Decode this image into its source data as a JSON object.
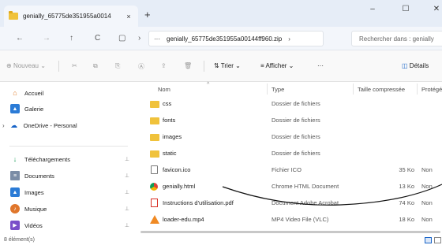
{
  "tab": {
    "title": "genially_65775de351955a0014",
    "close": "×",
    "new": "+"
  },
  "window_controls": {
    "minimize": "–",
    "maximize": "☐",
    "close": "✕"
  },
  "nav": {
    "back": "←",
    "forward": "→",
    "up": "↑",
    "refresh": "C",
    "view": "▢",
    "chevron": "›",
    "more": "···",
    "path": "genially_65775de351955a00144ff960.zip",
    "path_chevron": "›",
    "search_placeholder": "Rechercher dans : genially"
  },
  "toolbar": {
    "new_label": "Nouveau",
    "sort_label": "Trier",
    "view_label": "Afficher",
    "more": "···",
    "details_label": "Détails"
  },
  "sidebar": {
    "items": [
      {
        "label": "Accueil",
        "icon": "home-icon",
        "pinned": false
      },
      {
        "label": "Galerie",
        "icon": "gallery-icon",
        "pinned": false
      },
      {
        "label": "OneDrive - Personal",
        "icon": "cloud-icon",
        "pinned": false
      },
      {
        "label": "Téléchargements",
        "icon": "download-icon",
        "pinned": true
      },
      {
        "label": "Documents",
        "icon": "document-icon",
        "pinned": true
      },
      {
        "label": "Images",
        "icon": "image-icon",
        "pinned": true
      },
      {
        "label": "Musique",
        "icon": "music-icon",
        "pinned": true
      },
      {
        "label": "Vidéos",
        "icon": "video-icon",
        "pinned": true
      }
    ]
  },
  "columns": {
    "name": "Nom",
    "type": "Type",
    "compressed": "Taille compressée",
    "protected": "Protégé"
  },
  "files": [
    {
      "name": "css",
      "type": "Dossier de fichiers",
      "size": "",
      "protected": "",
      "icon": "folder-icon"
    },
    {
      "name": "fonts",
      "type": "Dossier de fichiers",
      "size": "",
      "protected": "",
      "icon": "folder-icon"
    },
    {
      "name": "images",
      "type": "Dossier de fichiers",
      "size": "",
      "protected": "",
      "icon": "folder-icon"
    },
    {
      "name": "static",
      "type": "Dossier de fichiers",
      "size": "",
      "protected": "",
      "icon": "folder-icon"
    },
    {
      "name": "favicon.ico",
      "type": "Fichier ICO",
      "size": "35 Ko",
      "protected": "Non",
      "icon": "file-icon"
    },
    {
      "name": "genially.html",
      "type": "Chrome HTML Document",
      "size": "13 Ko",
      "protected": "Non",
      "icon": "chrome-icon"
    },
    {
      "name": "Instructions d'utilisation.pdf",
      "type": "Document Adobe Acrobat",
      "size": "74 Ko",
      "protected": "Non",
      "icon": "pdf-icon"
    },
    {
      "name": "loader-edu.mp4",
      "type": "MP4 Video File (VLC)",
      "size": "18 Ko",
      "protected": "Non",
      "icon": "vlc-icon"
    }
  ],
  "status": {
    "count": "8 élément(s)"
  },
  "colors": {
    "accent": "#1763c7",
    "folder": "#f0c23b",
    "titlebar": "#e6edf7",
    "annotation": "#111111"
  }
}
